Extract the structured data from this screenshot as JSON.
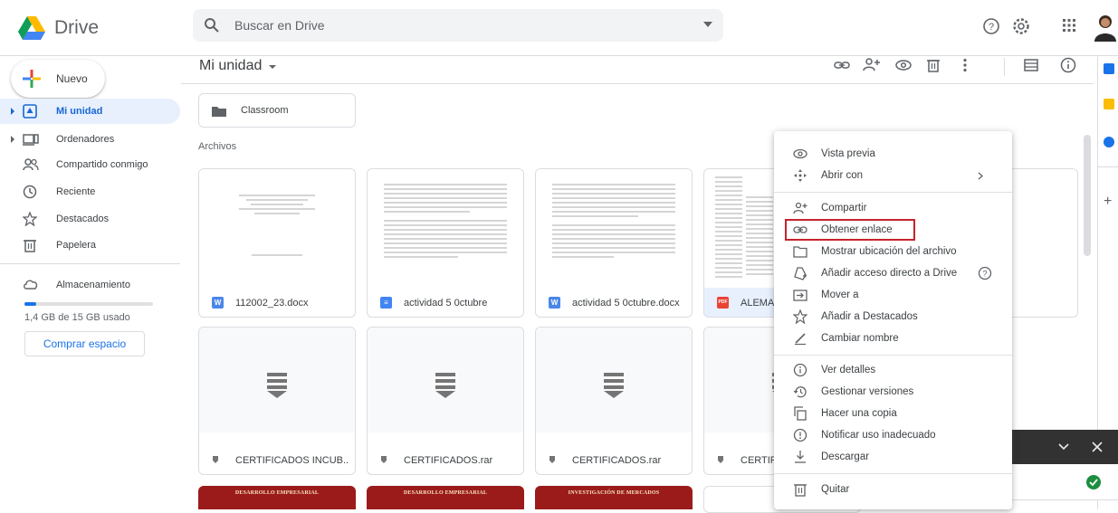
{
  "header": {
    "app_name": "Drive",
    "search_placeholder": "Buscar en Drive",
    "icons": [
      "help-icon",
      "settings-icon",
      "apps-icon"
    ]
  },
  "sidebar": {
    "new_label": "Nuevo",
    "items": [
      {
        "label": "Mi unidad",
        "icon": "my-drive-icon",
        "active": true,
        "expandable": true
      },
      {
        "label": "Ordenadores",
        "icon": "computers-icon",
        "active": false,
        "expandable": true
      },
      {
        "label": "Compartido conmigo",
        "icon": "shared-icon",
        "active": false,
        "expandable": false
      },
      {
        "label": "Reciente",
        "icon": "clock-icon",
        "active": false,
        "expandable": false
      },
      {
        "label": "Destacados",
        "icon": "star-icon",
        "active": false,
        "expandable": false
      },
      {
        "label": "Papelera",
        "icon": "trash-icon",
        "active": false,
        "expandable": false
      }
    ],
    "storage": {
      "label": "Almacenamiento",
      "used_text": "1,4 GB de 15 GB usado",
      "used_fraction": 0.093,
      "buy_label": "Comprar espacio"
    }
  },
  "main": {
    "title": "Mi unidad",
    "toolbar_icons": [
      "link-icon",
      "add-person-icon",
      "preview-icon",
      "trash-icon",
      "more-icon",
      "list-view-icon",
      "info-icon"
    ],
    "folders": [
      {
        "name": "Classroom"
      }
    ],
    "files_section_label": "Archivos",
    "files": [
      {
        "name": "112002_23.docx",
        "type": "word",
        "badge": "W"
      },
      {
        "name": "actividad 5 0ctubre",
        "type": "docs",
        "badge": "≡"
      },
      {
        "name": "actividad 5 0ctubre.docx",
        "type": "word",
        "badge": "W"
      },
      {
        "name": "ALEMA",
        "type": "pdf",
        "badge": "PDF"
      },
      {
        "name": "CERTIFICADOS INCUB...",
        "type": "zip"
      },
      {
        "name": "CERTIFICADOS.rar",
        "type": "zip"
      },
      {
        "name": "CERTIFICADOS.rar",
        "type": "zip"
      },
      {
        "name": "CERTIF",
        "type": "zip"
      }
    ],
    "bottom_banners": [
      "DESARROLLO EMPRESARIAL",
      "DESARROLLO EMPRESARIAL",
      "INVESTIGACIÓN DE MERCADOS"
    ]
  },
  "context_menu": {
    "items": [
      {
        "label": "Vista previa",
        "icon": "eye-icon"
      },
      {
        "label": "Abrir con",
        "icon": "open-with-icon",
        "submenu": true
      },
      {
        "label": "Compartir",
        "icon": "add-person-icon"
      },
      {
        "label": "Obtener enlace",
        "icon": "link-icon",
        "highlighted": true
      },
      {
        "label": "Mostrar ubicación del archivo",
        "icon": "folder-outline-icon"
      },
      {
        "label": "Añadir acceso directo a Drive",
        "icon": "shortcut-icon",
        "help": true
      },
      {
        "label": "Mover a",
        "icon": "move-icon"
      },
      {
        "label": "Añadir a Destacados",
        "icon": "star-icon"
      },
      {
        "label": "Cambiar nombre",
        "icon": "pencil-icon"
      },
      {
        "label": "Ver detalles",
        "icon": "info-icon"
      },
      {
        "label": "Gestionar versiones",
        "icon": "history-icon"
      },
      {
        "label": "Hacer una copia",
        "icon": "copy-icon"
      },
      {
        "label": "Notificar uso inadecuado",
        "icon": "report-icon"
      },
      {
        "label": "Descargar",
        "icon": "download-icon"
      },
      {
        "label": "Quitar",
        "icon": "trash-icon"
      }
    ]
  },
  "colors": {
    "accent": "#1a73e8",
    "active_bg": "#e8f0fe",
    "highlight_border": "#c5242d",
    "banner_red": "#9b1b1b"
  }
}
